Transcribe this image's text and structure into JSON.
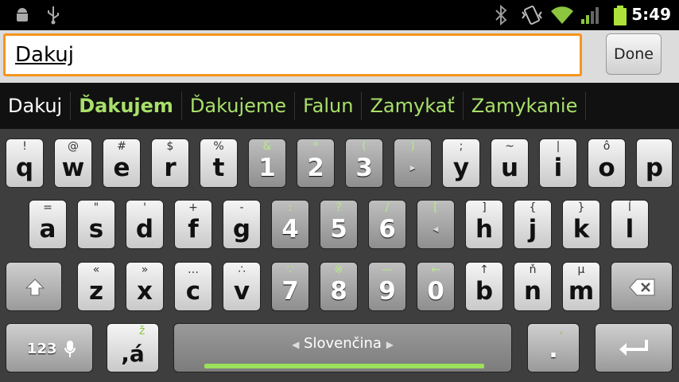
{
  "status": {
    "time": "5:49",
    "icons": [
      "android-icon",
      "usb-icon",
      "bluetooth-icon",
      "vibrate-icon",
      "wifi-icon",
      "signal-icon",
      "battery-icon"
    ]
  },
  "input": {
    "value": "Dakuj",
    "done_label": "Done",
    "accent": "#f7941d"
  },
  "suggestions": [
    "Dakuj",
    "Ďakujem",
    "Ďakujeme",
    "Falun",
    "Zamykať",
    "Zamykanie"
  ],
  "keyboard": {
    "row1": [
      {
        "main": "q",
        "hint": "!"
      },
      {
        "main": "w",
        "hint": "@"
      },
      {
        "main": "e",
        "hint": "#"
      },
      {
        "main": "r",
        "hint": "$"
      },
      {
        "main": "t",
        "hint": "%"
      },
      {
        "main": "1",
        "hint": "&"
      },
      {
        "main": "2",
        "hint": "*"
      },
      {
        "main": "3",
        "hint": "("
      },
      {
        "main": "",
        "hint": ")"
      },
      {
        "main": "y",
        "hint": ";"
      },
      {
        "main": "u",
        "hint": "~"
      },
      {
        "main": "i",
        "hint": "|"
      },
      {
        "main": "o",
        "hint": "ô"
      },
      {
        "main": "p",
        "hint": ""
      }
    ],
    "row2": [
      {
        "main": "a",
        "hint": "="
      },
      {
        "main": "s",
        "hint": "\""
      },
      {
        "main": "d",
        "hint": "'"
      },
      {
        "main": "f",
        "hint": "+"
      },
      {
        "main": "g",
        "hint": "-"
      },
      {
        "main": "4",
        "hint": ":"
      },
      {
        "main": "5",
        "hint": "?"
      },
      {
        "main": "6",
        "hint": "/"
      },
      {
        "main": "",
        "hint": "["
      },
      {
        "main": "h",
        "hint": "]"
      },
      {
        "main": "j",
        "hint": "{"
      },
      {
        "main": "k",
        "hint": "}"
      },
      {
        "main": "l",
        "hint": "ĺ"
      }
    ],
    "row3": [
      {
        "main": "z",
        "hint": "«"
      },
      {
        "main": "x",
        "hint": "»"
      },
      {
        "main": "c",
        "hint": "…"
      },
      {
        "main": "v",
        "hint": "∴"
      },
      {
        "main": "7",
        "hint": "∵"
      },
      {
        "main": "8",
        "hint": "※"
      },
      {
        "main": "9",
        "hint": "—"
      },
      {
        "main": "0",
        "hint": "←"
      },
      {
        "main": "b",
        "hint": "↑"
      },
      {
        "main": "n",
        "hint": "ň"
      },
      {
        "main": "m",
        "hint": "μ"
      }
    ],
    "mode_label": "123",
    "comma_label": ",á",
    "comma_hint": "ž",
    "space_label": "Slovenčina",
    "period_label": ".",
    "period_hint": "'"
  }
}
